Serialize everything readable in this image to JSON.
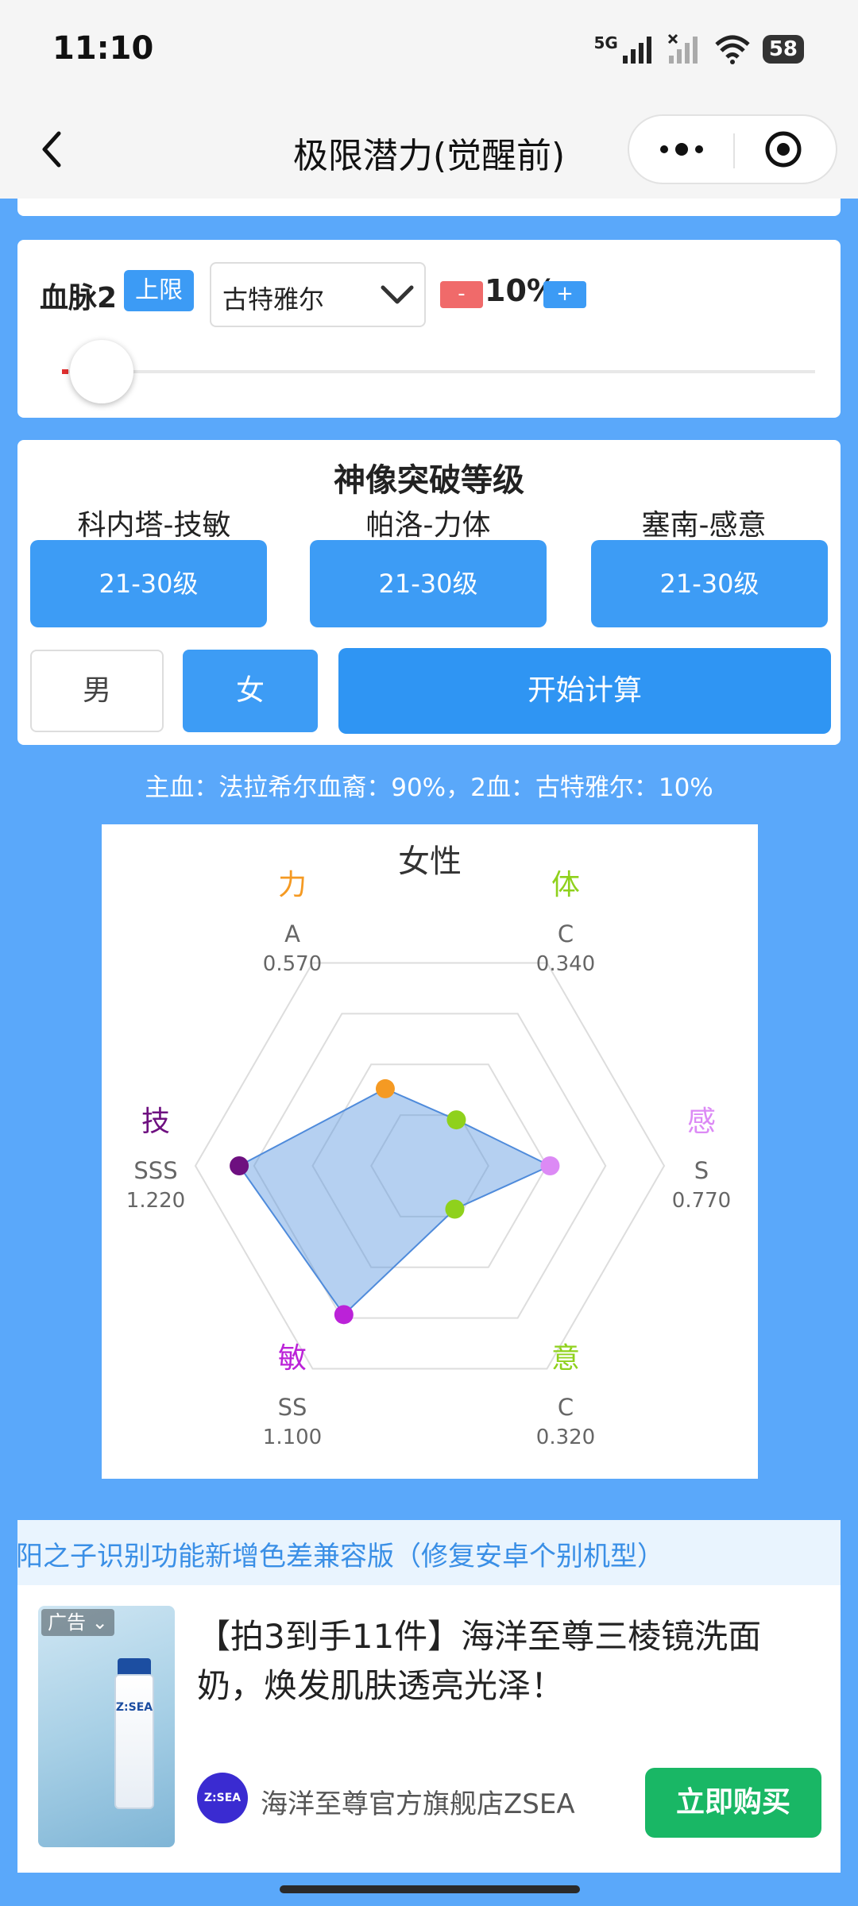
{
  "status_bar": {
    "time": "11:10",
    "network": "5G",
    "battery": "58"
  },
  "nav": {
    "title": "极限潜力(觉醒前)"
  },
  "blood": {
    "label": "血脉2",
    "limit_badge": "上限",
    "selected": "古特雅尔",
    "minus": "-",
    "percent": "10%",
    "plus": "+",
    "slider_value_percent": 10,
    "slider_fill_color": "#e03030"
  },
  "statue": {
    "title": "神像突破等级",
    "columns": [
      {
        "label": "科内塔-技敏",
        "level": "21-30级"
      },
      {
        "label": "帕洛-力体",
        "level": "21-30级"
      },
      {
        "label": "塞南-感意",
        "level": "21-30级"
      }
    ],
    "male": "男",
    "female": "女",
    "selected_gender": "女",
    "calc_button": "开始计算"
  },
  "summary": "主血：法拉希尔血裔：90%，2血：古特雅尔：10%",
  "chart_data": {
    "type": "radar",
    "title": "女性",
    "max": 1.5,
    "rings": 4,
    "axes": [
      {
        "name": "力",
        "grade": "A",
        "value": 0.57,
        "value_label": "0.570",
        "color": "#f59a23"
      },
      {
        "name": "体",
        "grade": "C",
        "value": 0.34,
        "value_label": "0.340",
        "color": "#8fd11c"
      },
      {
        "name": "感",
        "grade": "S",
        "value": 0.77,
        "value_label": "0.770",
        "color": "#dc8af5"
      },
      {
        "name": "意",
        "grade": "C",
        "value": 0.32,
        "value_label": "0.320",
        "color": "#8fd11c"
      },
      {
        "name": "敏",
        "grade": "SS",
        "value": 1.1,
        "value_label": "1.100",
        "color": "#bb22d8"
      },
      {
        "name": "技",
        "grade": "SSS",
        "value": 1.22,
        "value_label": "1.220",
        "color": "#6e1080"
      }
    ],
    "fill_color": "#5a97e0",
    "line_color": "#4f8bdb"
  },
  "news": "阳之子识别功能新增色差兼容版（修复安卓个别机型）",
  "ad": {
    "badge": "广告",
    "product_brand": "Z:SEA",
    "title": "【拍3到手11件】海洋至尊三棱镜洗面奶，焕发肌肤透亮光泽！",
    "brand_logo": "Z:SEA",
    "brand_name": "海洋至尊官方旗舰店ZSEA",
    "buy_button": "立即购买"
  }
}
